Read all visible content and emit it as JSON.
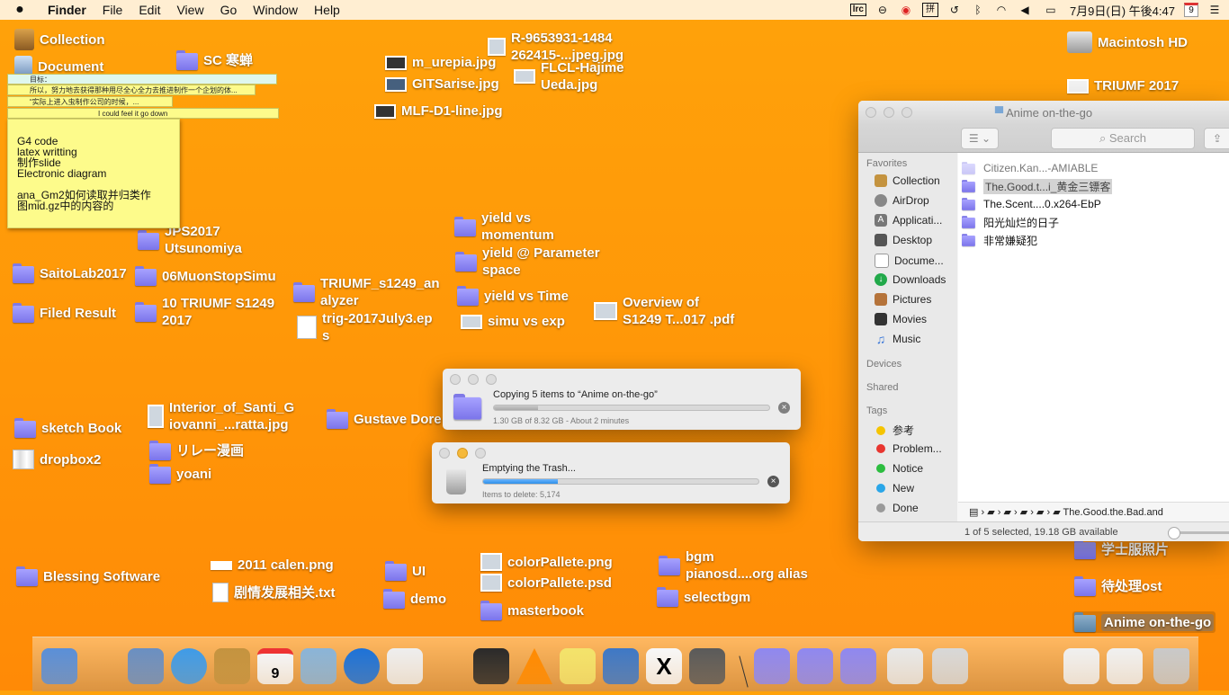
{
  "menubar": {
    "app": "Finder",
    "menus": [
      "File",
      "Edit",
      "View",
      "Go",
      "Window",
      "Help"
    ],
    "lrc": "lrc",
    "datetime": "7月9日(日) 午後4:47",
    "calendar_day": "9"
  },
  "desktop": {
    "collection": "Collection",
    "document": "Document",
    "sc": "SC 寒蝉",
    "m_urepia": "m_urepia.jpg",
    "gitsarise": "GITSarise.jpg",
    "mlf": "MLF-D1-line.jpg",
    "r965_1": "R-9653931-1484",
    "r965_2": "262415-...jpeg.jpg",
    "flcl_1": "FLCL-Hajime",
    "flcl_2": "Ueda.jpg",
    "macintosh": "Macintosh HD",
    "triumf2017": "TRIUMF 2017",
    "jps_1": "JPS2017",
    "jps_2": "Utsunomiya",
    "saitolab": "SaitoLab2017",
    "muon": "06MuonStopSimu",
    "filed": "Filed Result",
    "triumf_s1249_1": "10 TRIUMF S1249",
    "triumf_s1249_2": "2017",
    "ana_1": "TRIUMF_s1249_an",
    "ana_2": "alyzer",
    "trig_1": "trig-2017July3.ep",
    "trig_2": "s",
    "yield_mom_1": "yield vs",
    "yield_mom_2": "momentum",
    "yield_par_1": "yield @ Parameter",
    "yield_par_2": "space",
    "yield_time": "yield vs Time",
    "simu_exp": "simu vs exp",
    "overview_1": "Overview of",
    "overview_2": "S1249 T...017 .pdf",
    "sketch": "sketch Book",
    "dropbox": "dropbox2",
    "interior_1": "Interior_of_Santi_G",
    "interior_2": "iovanni_...ratta.jpg",
    "relay": "リレー漫画",
    "yoani": "yoani",
    "gustave": "Gustave Dore",
    "blessing": "Blessing Software",
    "calen": "2011 calen.png",
    "story": "剧情发展相关.txt",
    "ui": "UI",
    "demo": "demo",
    "pallete_png": "colorPallete.png",
    "pallete_psd": "colorPallete.psd",
    "masterbook": "masterbook",
    "bgm_1": "bgm",
    "bgm_2": "pianosd....org alias",
    "selectbgm": "selectbgm",
    "gakushi": "学士服照片",
    "ost": "待处理ost",
    "anime": "Anime on-the-go"
  },
  "sticky": {
    "strip1": "目标：",
    "strip2": "所以，努力地去获得那种用尽全心全力去推进制作一个企划的体...",
    "strip3": "“实际上进入虫制作公司的时候，...",
    "strip4": "I could feel it go down",
    "body": "G4 code\nlatex writting\n制作slide\nElectronic diagram\n\nana_Gm2如何读取并归类作\n图mid.gz中的内容的"
  },
  "finder": {
    "title": "Anime on-the-go",
    "search_placeholder": "Search",
    "favorites_header": "Favorites",
    "favorites": [
      "Collection",
      "AirDrop",
      "Applicati...",
      "Desktop",
      "Docume...",
      "Downloads",
      "Pictures",
      "Movies",
      "Music"
    ],
    "devices_header": "Devices",
    "shared_header": "Shared",
    "tags_header": "Tags",
    "tags": [
      {
        "label": "参考",
        "color": "#f5c400"
      },
      {
        "label": "Problem...",
        "color": "#e8352f"
      },
      {
        "label": "Notice",
        "color": "#2cbd3f"
      },
      {
        "label": "New",
        "color": "#2aa6e8"
      },
      {
        "label": "Done",
        "color": "#9a9a9a"
      }
    ],
    "files": [
      "Citizen.Kan...-AMIABLE",
      "The.Good.t...i_黄金三镖客",
      "The.Scent....0.x264-EbP",
      "阳光灿烂的日子",
      "非常嫌疑犯"
    ],
    "path_last": "The.Good.the.Bad.and",
    "status": "1 of 5 selected, 19.18 GB available"
  },
  "copy_dialog": {
    "message": "Copying 5 items to “Anime on-the-go”",
    "detail": "1.30 GB of 8.32 GB - About 2 minutes",
    "progress": 0.16
  },
  "trash_dialog": {
    "message": "Emptying the Trash...",
    "detail": "Items to delete: 5,174",
    "progress": 0.27
  },
  "dock": {
    "calendar_day": "9",
    "colors": [
      "#5a8fd8",
      "#333",
      "#6a8fc2",
      "#3f9be8",
      "#c4933f",
      "#f4f4f4",
      "#8ab4d8",
      "#1d72d8",
      "#eeeeee",
      "#222",
      "#2a2a2a",
      "#ff8a00",
      "#f3e36b",
      "#3e78c6",
      "#f7f7f7",
      "#5a5a5a",
      "#8f88f0",
      "#8f88f0",
      "#8f88f0",
      "#e8e8e8",
      "#d8d8d8",
      "#222",
      "#222",
      "#f0f0f0",
      "#f0f0f0",
      "#c9c9c9"
    ]
  }
}
